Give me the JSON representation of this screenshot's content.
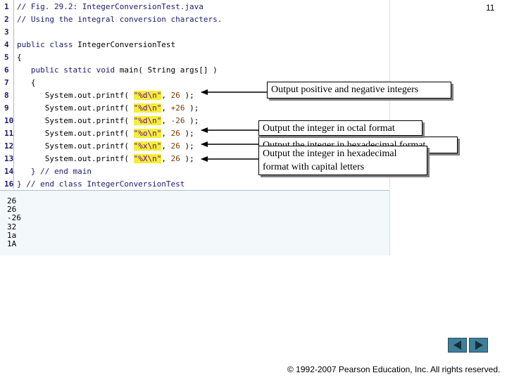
{
  "slide_number": "11",
  "code_lines": [
    {
      "num": "1",
      "segments": [
        {
          "t": "// Fig. 29.2: IntegerConversionTest.java",
          "c": "comment"
        }
      ]
    },
    {
      "num": "2",
      "segments": [
        {
          "t": "// Using the integral conversion characters.",
          "c": "comment"
        }
      ]
    },
    {
      "num": "3",
      "segments": []
    },
    {
      "num": "4",
      "segments": [
        {
          "t": "public class ",
          "c": "kw"
        },
        {
          "t": "IntegerConversionTest",
          "c": "plain"
        }
      ]
    },
    {
      "num": "5",
      "segments": [
        {
          "t": "{",
          "c": "plain"
        }
      ]
    },
    {
      "num": "6",
      "segments": [
        {
          "t": "   public static void ",
          "c": "kw"
        },
        {
          "t": "main( String args[] )",
          "c": "plain"
        }
      ]
    },
    {
      "num": "7",
      "segments": [
        {
          "t": "   {",
          "c": "plain"
        }
      ]
    },
    {
      "num": "8",
      "segments": [
        {
          "t": "      System.out.printf( ",
          "c": "plain"
        },
        {
          "t": "\"%d\\n\"",
          "c": "str"
        },
        {
          "t": ", ",
          "c": "plain"
        },
        {
          "t": "26",
          "c": "num"
        },
        {
          "t": " );",
          "c": "plain"
        }
      ]
    },
    {
      "num": "9",
      "segments": [
        {
          "t": "      System.out.printf( ",
          "c": "plain"
        },
        {
          "t": "\"%d\\n\"",
          "c": "str"
        },
        {
          "t": ", ",
          "c": "plain"
        },
        {
          "t": "+26",
          "c": "num"
        },
        {
          "t": " );",
          "c": "plain"
        }
      ]
    },
    {
      "num": "10",
      "segments": [
        {
          "t": "      System.out.printf( ",
          "c": "plain"
        },
        {
          "t": "\"%d\\n\"",
          "c": "str"
        },
        {
          "t": ", ",
          "c": "plain"
        },
        {
          "t": "-26",
          "c": "num"
        },
        {
          "t": " );",
          "c": "plain"
        }
      ]
    },
    {
      "num": "11",
      "segments": [
        {
          "t": "      System.out.printf( ",
          "c": "plain"
        },
        {
          "t": "\"%o\\n\"",
          "c": "str"
        },
        {
          "t": ", ",
          "c": "plain"
        },
        {
          "t": "26",
          "c": "num"
        },
        {
          "t": " );",
          "c": "plain"
        }
      ]
    },
    {
      "num": "12",
      "segments": [
        {
          "t": "      System.out.printf( ",
          "c": "plain"
        },
        {
          "t": "\"%x\\n\"",
          "c": "str"
        },
        {
          "t": ", ",
          "c": "plain"
        },
        {
          "t": "26",
          "c": "num"
        },
        {
          "t": " );",
          "c": "plain"
        }
      ]
    },
    {
      "num": "13",
      "segments": [
        {
          "t": "      System.out.printf( ",
          "c": "plain"
        },
        {
          "t": "\"%X\\n\"",
          "c": "str"
        },
        {
          "t": ", ",
          "c": "plain"
        },
        {
          "t": "26",
          "c": "num"
        },
        {
          "t": " );",
          "c": "plain"
        }
      ]
    },
    {
      "num": "14",
      "segments": [
        {
          "t": "   } // end main",
          "c": "comment"
        }
      ]
    },
    {
      "num": "16",
      "segments": [
        {
          "t": "} // end class IntegerConversionTest",
          "c": "comment"
        }
      ]
    }
  ],
  "output_lines": [
    "26",
    "26",
    "-26",
    "32",
    "1a",
    "1A"
  ],
  "callouts": {
    "positive_negative": "Output positive and negative integers",
    "octal": "Output the integer in octal format",
    "hex_lower": "Output the integer in hexadecimal format",
    "hex_upper_line1": "Output the integer in hexadecimal",
    "hex_upper_line2": "format with capital letters"
  },
  "footer": "© 1992-2007 Pearson Education, Inc.  All rights reserved.",
  "nav": {
    "prev_icon": "triangle-left-icon",
    "next_icon": "triangle-right-icon"
  },
  "colors": {
    "code_comment": "#1a1a70",
    "string_highlight": "#f4ef33",
    "nav_button": "#3e7f9a"
  }
}
